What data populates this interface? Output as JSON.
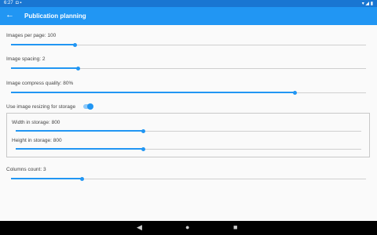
{
  "status_bar": {
    "time": "6:27",
    "left_icons": "◘ ▪",
    "right_icons": "▾ ◢ ▮"
  },
  "app_bar": {
    "back_icon": "←",
    "title": "Publication planning"
  },
  "settings": {
    "images_per_page": {
      "label": "Images per page: 100",
      "fraction": 0.18
    },
    "image_spacing": {
      "label": "Image spacing: 2",
      "fraction": 0.19
    },
    "compress_quality": {
      "label": "Image compress quality: 80%",
      "fraction": 0.8
    },
    "resize_toggle": {
      "label": "Use image resizing for storage",
      "checked": true
    },
    "width_storage": {
      "label": "Width in storage: 800",
      "fraction": 0.37
    },
    "height_storage": {
      "label": "Height in storage: 800",
      "fraction": 0.37
    },
    "columns_count": {
      "label": "Columns count: 3",
      "fraction": 0.2
    }
  },
  "nav_bar": {
    "back_icon": "◀",
    "home_icon": "●",
    "recents_icon": "■"
  },
  "colors": {
    "accent": "#2196f3",
    "app_bar": "#2196f3",
    "status_bar": "#1976d2"
  }
}
